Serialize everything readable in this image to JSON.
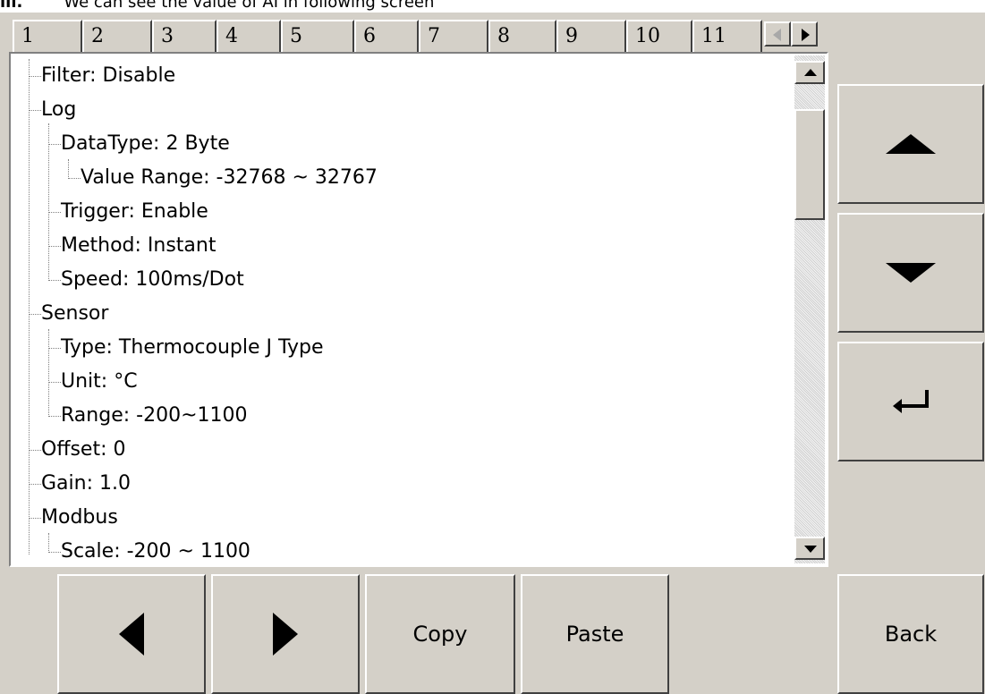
{
  "caption": {
    "marker": "iii.",
    "text": "We can see the value of AI in following screen"
  },
  "tabs": [
    "1",
    "2",
    "3",
    "4",
    "5",
    "6",
    "7",
    "8",
    "9",
    "10",
    "11"
  ],
  "active_tab": "1",
  "tree": {
    "filter": "Filter: Disable",
    "log": "Log",
    "datatype": "DataType: 2 Byte",
    "value_range": "Value Range: -32768 ~ 32767",
    "trigger": "Trigger: Enable",
    "method": "Method: Instant",
    "speed": "Speed: 100ms/Dot",
    "sensor": "Sensor",
    "type": "Type: Thermocouple J Type",
    "unit": "Unit: °C",
    "range": "Range: -200~1100",
    "offset": "Offset: 0",
    "gain": "Gain: 1.0",
    "modbus": "Modbus",
    "scale": "Scale: -200 ~ 1100"
  },
  "side_buttons": {
    "up_icon": "up-arrow-icon",
    "down_icon": "down-arrow-icon",
    "enter_icon": "enter-return-icon"
  },
  "bottom_buttons": {
    "prev_icon": "left-arrow-icon",
    "next_icon": "right-arrow-icon",
    "copy": "Copy",
    "paste": "Paste",
    "back": "Back"
  },
  "colors": {
    "panel_bg": "#d4d0c8",
    "tree_bg": "#ffffff",
    "text": "#000000"
  }
}
